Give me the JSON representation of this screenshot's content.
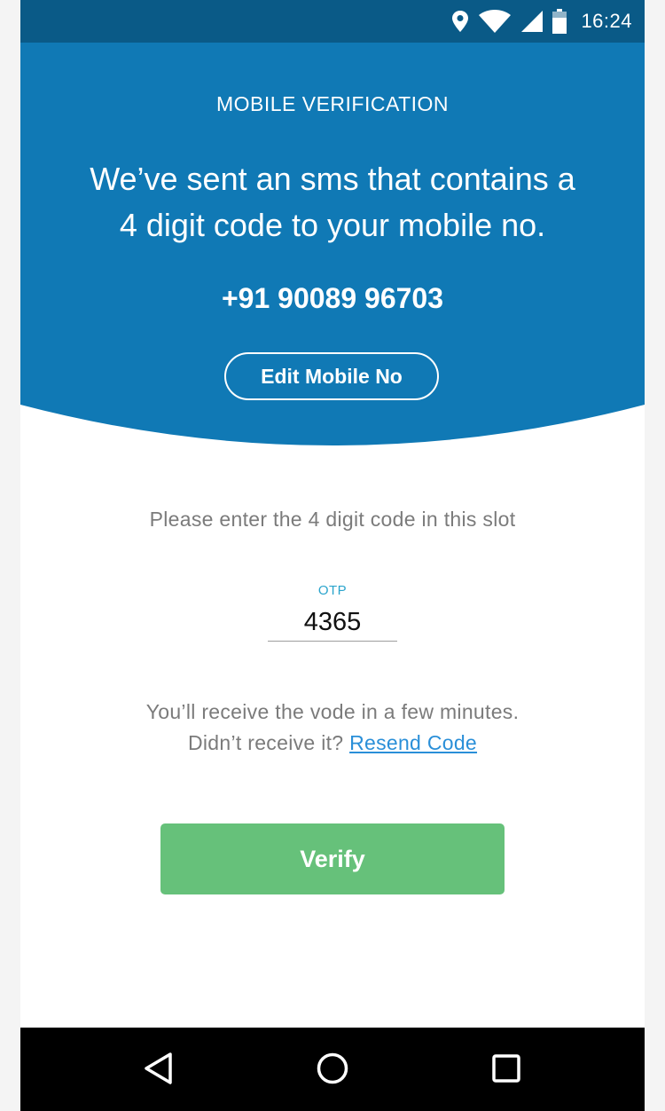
{
  "status_bar": {
    "time": "16:24",
    "icons": [
      "location-icon",
      "wifi-icon",
      "cell-signal-icon",
      "battery-icon"
    ]
  },
  "header": {
    "title": "MOBILE VERIFICATION",
    "message_line1": "We’ve sent an sms that contains a",
    "message_line2": "4 digit code to your mobile no.",
    "phone_number": "+91 90089 96703",
    "edit_button_label": "Edit Mobile No",
    "background_color": "#1079b5"
  },
  "content": {
    "instruction": "Please enter the 4 digit code in this slot",
    "otp_label": "OTP",
    "otp_value": "4365",
    "receive_line1": "You’ll receive the vode in a few minutes.",
    "receive_line2_prefix": "Didn’t receive it? ",
    "resend_label": "Resend Code",
    "verify_label": "Verify",
    "verify_color": "#66c17a",
    "link_color": "#2a8fd8"
  },
  "nav_bar": {
    "buttons": [
      "back-icon",
      "home-icon",
      "recents-icon"
    ]
  }
}
